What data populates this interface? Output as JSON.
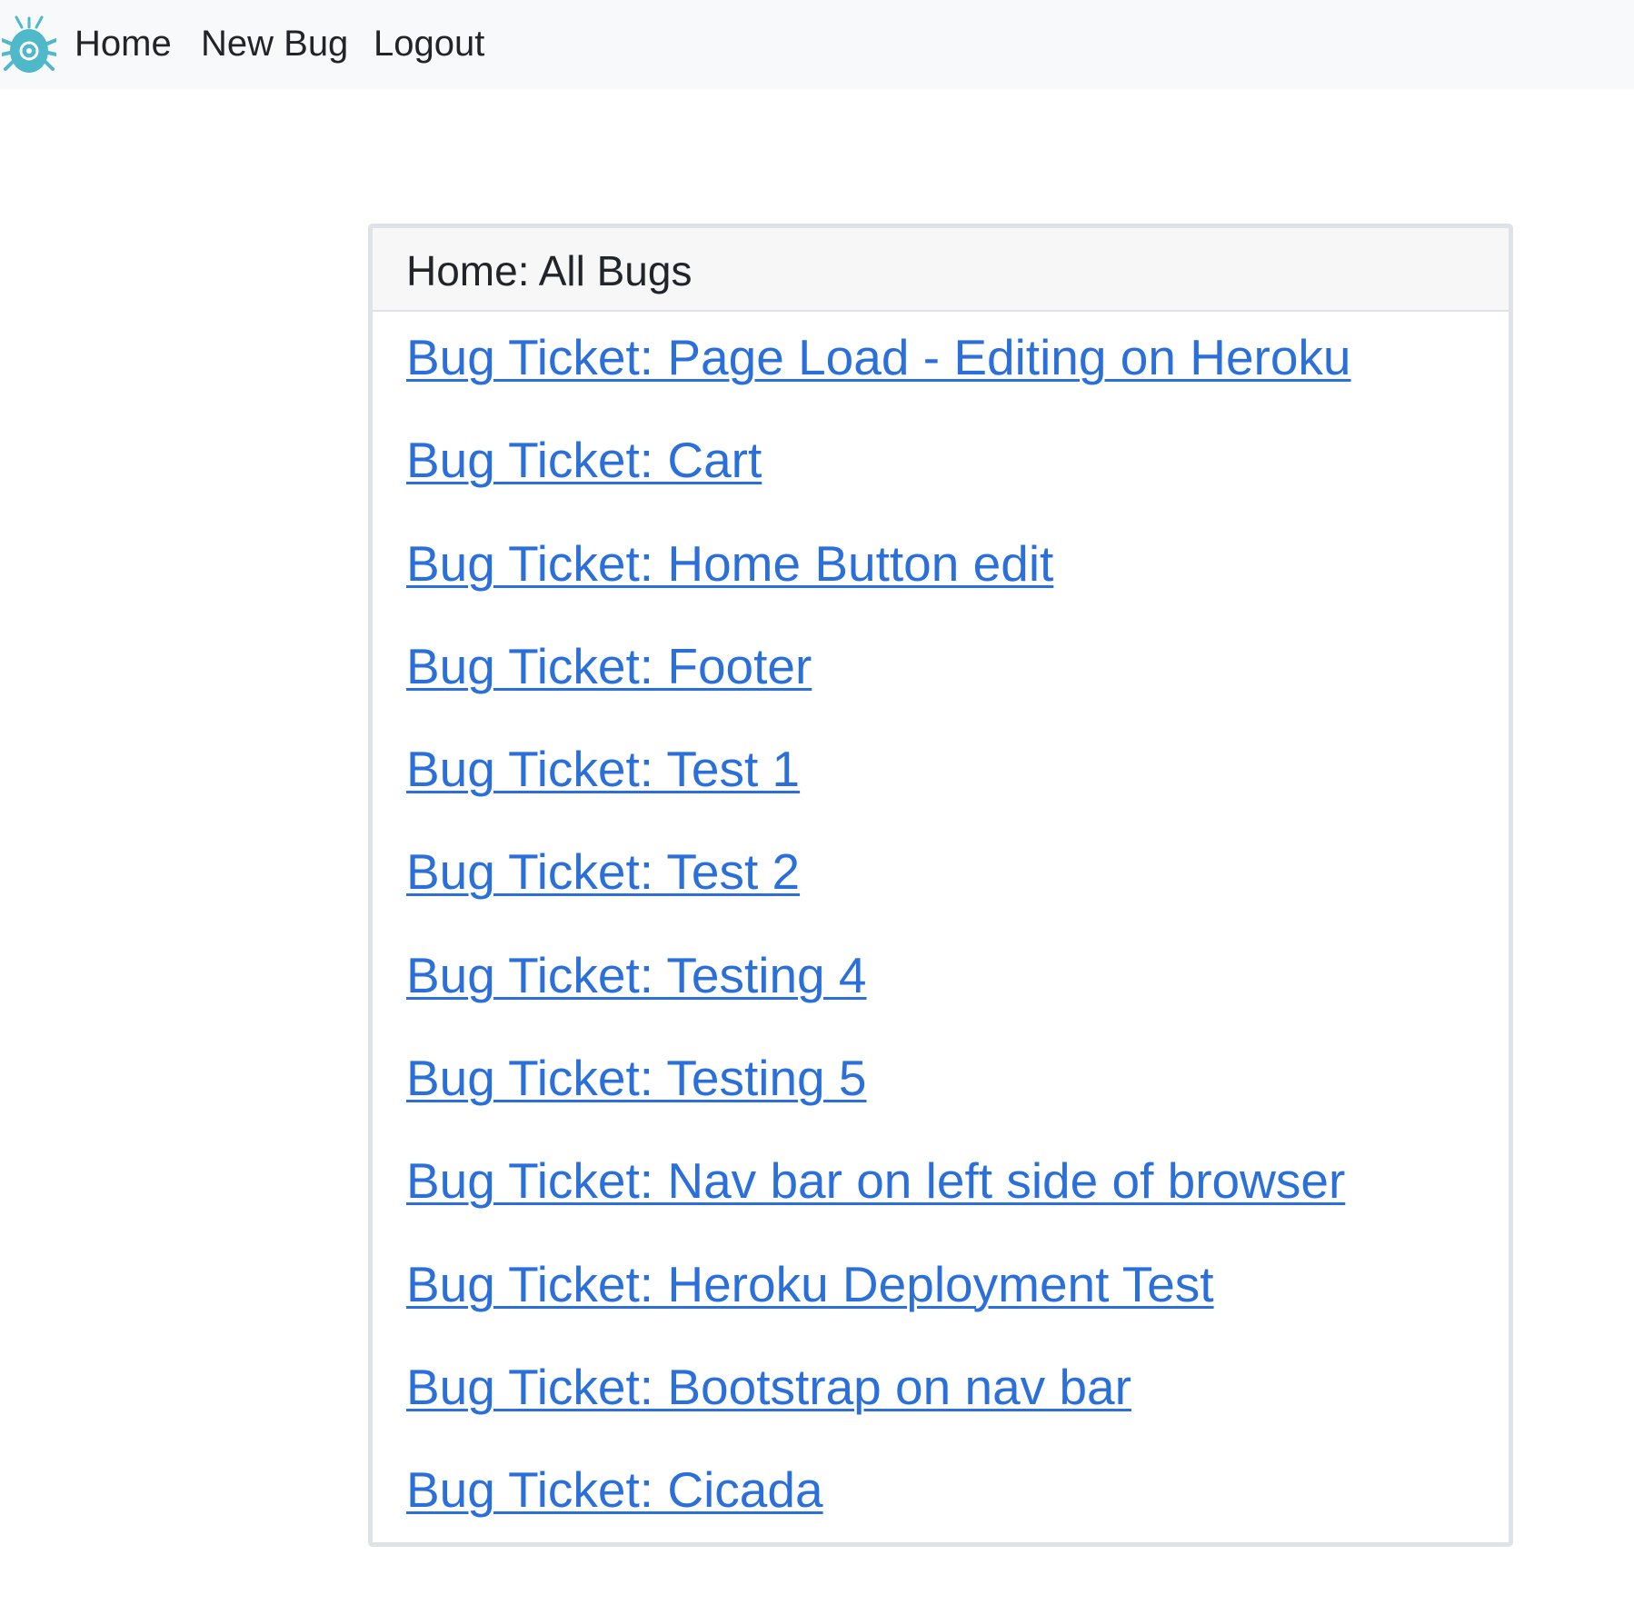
{
  "navbar": {
    "logo_icon": "bug-icon",
    "logo_color": "#4fb8c9",
    "links": [
      {
        "label": "Home"
      },
      {
        "label": "New Bug"
      },
      {
        "label": "Logout"
      }
    ]
  },
  "card": {
    "title": "Home: All Bugs",
    "bugs": [
      {
        "label": "Bug Ticket: Page Load - Editing on Heroku"
      },
      {
        "label": "Bug Ticket: Cart"
      },
      {
        "label": "Bug Ticket: Home Button edit"
      },
      {
        "label": "Bug Ticket: Footer"
      },
      {
        "label": "Bug Ticket: Test 1"
      },
      {
        "label": "Bug Ticket: Test 2"
      },
      {
        "label": "Bug Ticket: Testing 4"
      },
      {
        "label": "Bug Ticket: Testing 5"
      },
      {
        "label": "Bug Ticket: Nav bar on left side of browser"
      },
      {
        "label": "Bug Ticket: Heroku Deployment Test"
      },
      {
        "label": "Bug Ticket: Bootstrap on nav bar"
      },
      {
        "label": "Bug Ticket: Cicada"
      }
    ]
  },
  "colors": {
    "link": "#2b6fdb",
    "navbar_bg": "#f8f9fa",
    "card_border": "#dfe2e6"
  }
}
